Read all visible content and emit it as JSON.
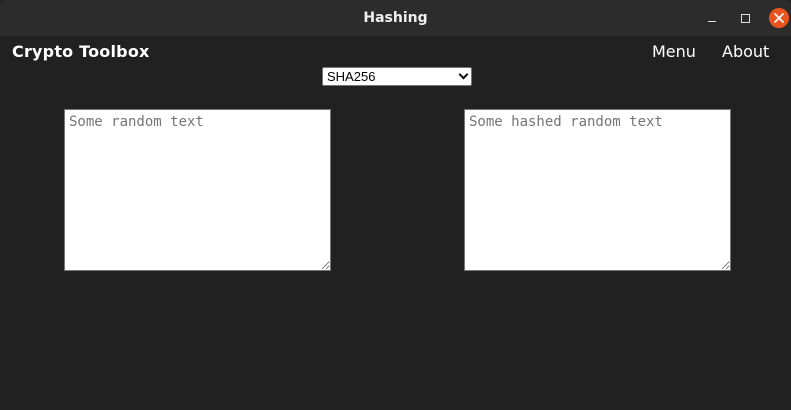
{
  "window": {
    "title": "Hashing",
    "close_color": "#e9541e",
    "background": "#212121"
  },
  "header": {
    "brand": "Crypto Toolbox",
    "nav": {
      "menu": "Menu",
      "about": "About"
    }
  },
  "controls": {
    "algorithm": {
      "selected": "SHA256"
    }
  },
  "input": {
    "placeholder": "Some random text",
    "value": ""
  },
  "output": {
    "placeholder": "Some hashed random text",
    "value": ""
  },
  "icons": {
    "minimize": "minimize-icon",
    "maximize": "maximize-icon",
    "close": "close-icon",
    "dropdown": "chevron-down-icon"
  }
}
